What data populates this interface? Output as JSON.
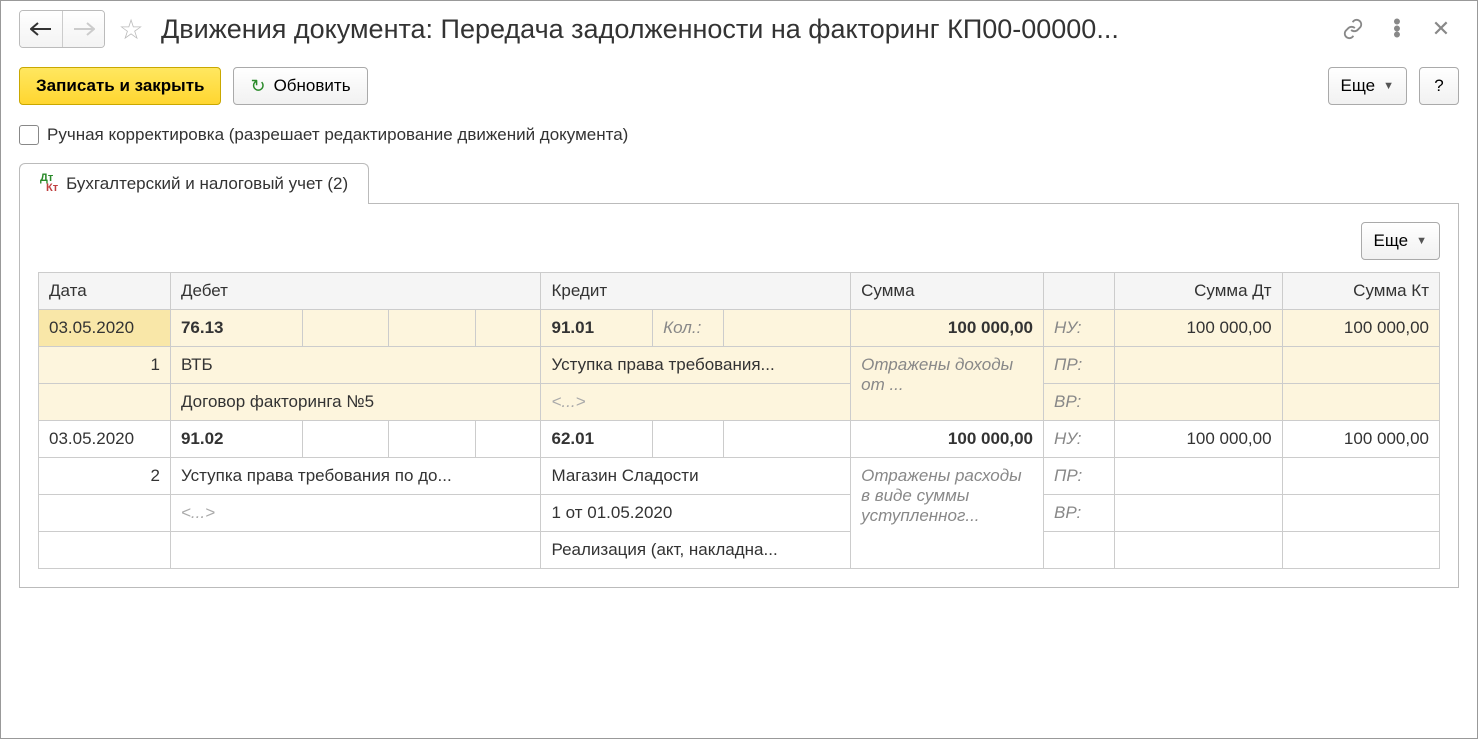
{
  "title": "Движения документа: Передача задолженности на факторинг КП00-00000...",
  "toolbar": {
    "save_close": "Записать и закрыть",
    "refresh": "Обновить",
    "more": "Еще",
    "help": "?"
  },
  "checkbox_label": "Ручная корректировка (разрешает редактирование движений документа)",
  "tab_label": "Бухгалтерский и налоговый учет (2)",
  "inner_more": "Еще",
  "headers": {
    "date": "Дата",
    "debit": "Дебет",
    "credit": "Кредит",
    "sum": "Сумма",
    "sum_dt": "Сумма Дт",
    "sum_kt": "Сумма Кт"
  },
  "labels": {
    "qty": "Кол.:",
    "nu": "НУ:",
    "pr": "ПР:",
    "vr": "ВР:",
    "empty": "<...>"
  },
  "rows": [
    {
      "date": "03.05.2020",
      "n": "1",
      "debit_acc": "76.13",
      "credit_acc": "91.01",
      "sum": "100 000,00",
      "sum_dt": "100 000,00",
      "sum_kt": "100 000,00",
      "debit_sub1": "ВТБ",
      "credit_sub1": "Уступка права требования...",
      "desc": "Отражены доходы от ...",
      "debit_sub2": "Договор факторинга №5",
      "credit_sub2": "<...>"
    },
    {
      "date": "03.05.2020",
      "n": "2",
      "debit_acc": "91.02",
      "credit_acc": "62.01",
      "sum": "100 000,00",
      "sum_dt": "100 000,00",
      "sum_kt": "100 000,00",
      "debit_sub1": "Уступка права требования по до...",
      "credit_sub1": "Магазин Сладости",
      "desc": "Отражены расходы в виде суммы уступленног...",
      "debit_sub2": "<...>",
      "credit_sub2": "1 от 01.05.2020",
      "credit_sub3": "Реализация (акт, накладна..."
    }
  ]
}
